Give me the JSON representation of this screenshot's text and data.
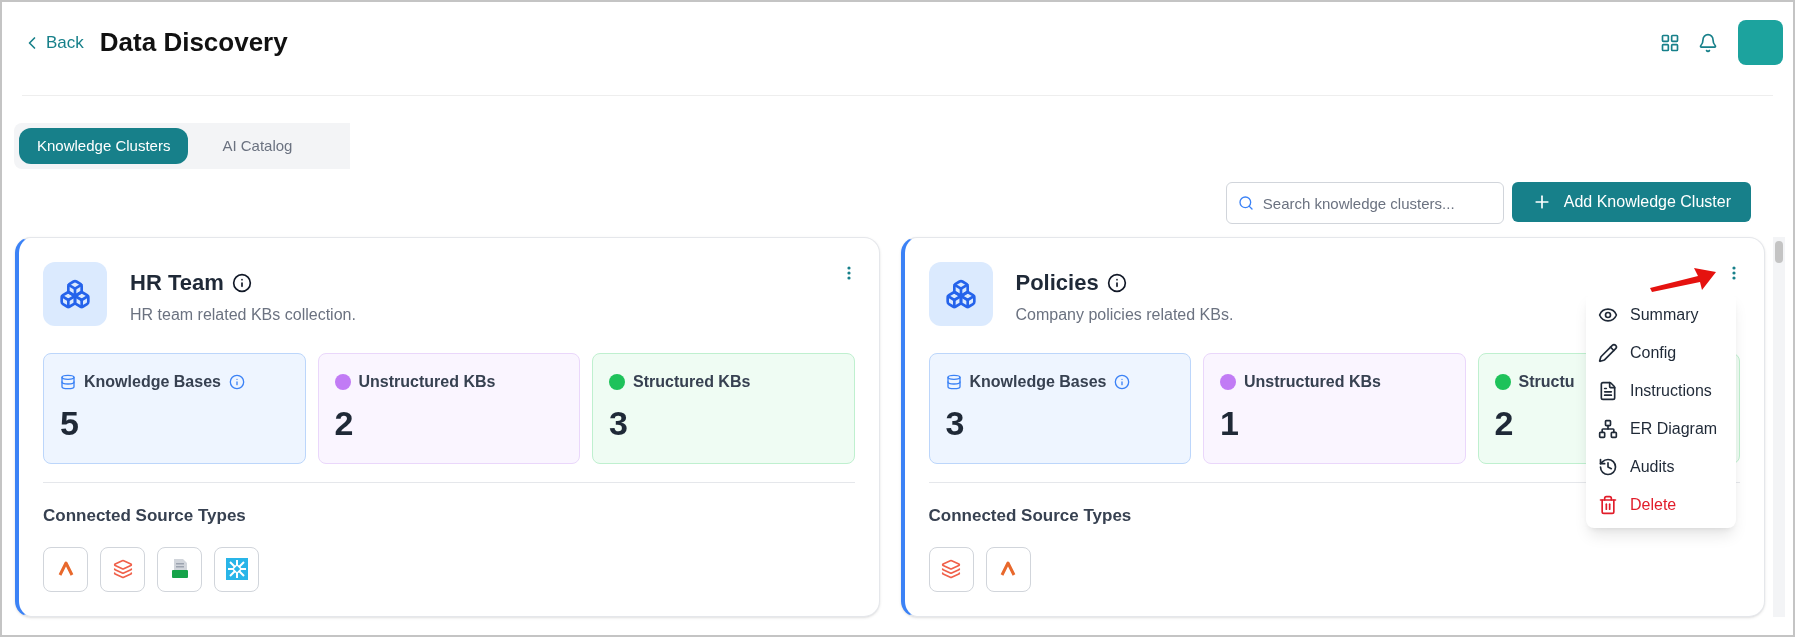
{
  "header": {
    "back": "Back",
    "title": "Data Discovery"
  },
  "tabs": [
    {
      "label": "Knowledge Clusters",
      "selected": true
    },
    {
      "label": "AI Catalog",
      "selected": false
    }
  ],
  "search": {
    "placeholder": "Search knowledge clusters..."
  },
  "add_button": "Add Knowledge Cluster",
  "clusters": [
    {
      "name": "HR Team",
      "description": "HR team related KBs collection.",
      "menu_open": false,
      "stats": [
        {
          "kind": "total",
          "label": "Knowledge Bases",
          "value": "5"
        },
        {
          "kind": "unstructured",
          "label": "Unstructured KBs",
          "value": "2"
        },
        {
          "kind": "structured",
          "label": "Structured KBs",
          "value": "3"
        }
      ],
      "sources_title": "Connected Source Types",
      "sources": [
        {
          "kind": "caret"
        },
        {
          "kind": "layers"
        },
        {
          "kind": "csv"
        },
        {
          "kind": "snowflake"
        }
      ]
    },
    {
      "name": "Policies",
      "description": "Company policies related KBs.",
      "menu_open": true,
      "stats": [
        {
          "kind": "total",
          "label": "Knowledge Bases",
          "value": "3"
        },
        {
          "kind": "unstructured",
          "label": "Unstructured KBs",
          "value": "1"
        },
        {
          "kind": "structured",
          "label": "Structu",
          "value": "2"
        }
      ],
      "sources_title": "Connected Source Types",
      "sources": [
        {
          "kind": "layers"
        },
        {
          "kind": "caret"
        }
      ]
    }
  ],
  "menu": [
    {
      "kind": "eye",
      "label": "Summary",
      "destructive": false
    },
    {
      "kind": "pencil",
      "label": "Config",
      "destructive": false
    },
    {
      "kind": "file",
      "label": "Instructions",
      "destructive": false
    },
    {
      "kind": "diagram",
      "label": "ER Diagram",
      "destructive": false
    },
    {
      "kind": "history",
      "label": "Audits",
      "destructive": false
    },
    {
      "kind": "trash",
      "label": "Delete",
      "destructive": true
    }
  ]
}
